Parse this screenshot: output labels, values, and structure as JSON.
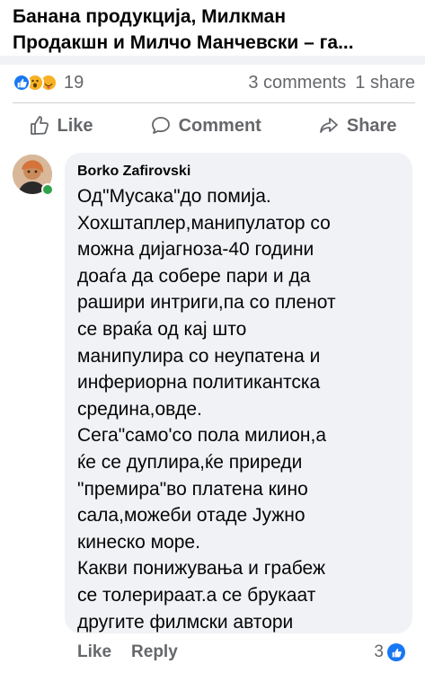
{
  "post": {
    "title_lines": [
      "Банана продукција, Милкман",
      "Продакшн и Милчо Манчевски – га..."
    ]
  },
  "reactions": {
    "icons": [
      "like-icon",
      "wow-icon",
      "care-icon"
    ],
    "count": "19",
    "comments": "3 comments",
    "shares": "1 share"
  },
  "actions": {
    "like": "Like",
    "comment": "Comment",
    "share": "Share"
  },
  "comment": {
    "author": "Borko Zafirovski",
    "lines": [
      "Од\"Мусака\"до помија.",
      "Хохштаплер,манипулатор со",
      "можна дијагноза-40 години",
      "доаѓа да собере пари и да",
      "рашири интриги,па со пленот",
      "се враќа од кај што",
      "манипулира со неупатена и",
      "инфериорна политикантска",
      "средина,овде.",
      "Сега\"само'со пола милион,а",
      "ќе се дуплира,ќе приреди",
      "\"премира\"во платена кино",
      "сала,можеби отаде Јужно",
      "кинеско море.",
      "Какви понижувања и грабеж",
      "се толерираат.а се брукаат",
      "другите филмски автори"
    ],
    "like_label": "Like",
    "reply_label": "Reply",
    "reaction_count": "3"
  },
  "colors": {
    "accent": "#1877f2",
    "secondary_text": "#65676b",
    "bubble": "#f0f2f5",
    "online": "#31a24c"
  }
}
